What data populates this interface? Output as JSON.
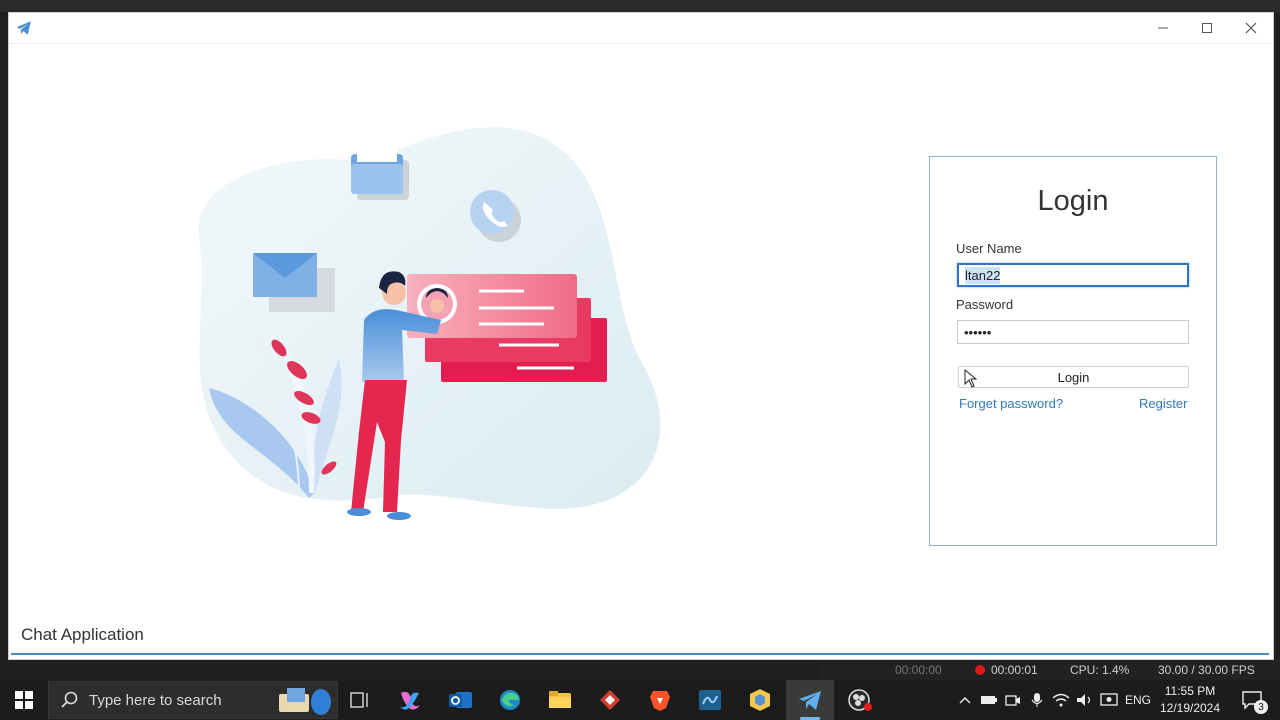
{
  "window": {
    "minimize_symbol": "—",
    "maximize_symbol": "☐",
    "close_symbol": "✕"
  },
  "login": {
    "title": "Login",
    "username_label": "User Name",
    "username_value": "ltan22",
    "password_label": "Password",
    "password_value": "••••••",
    "login_button": "Login",
    "forget_password": "Forget password?",
    "register": "Register"
  },
  "footer": {
    "app_title": "Chat Application"
  },
  "obs": {
    "stream_time": "00:00:00",
    "record_time": "00:00:01",
    "cpu": "CPU: 1.4%",
    "fps": "30.00 / 30.00 FPS"
  },
  "taskbar": {
    "search_placeholder": "Type here to search",
    "language": "ENG",
    "time": "11:55 PM",
    "date": "12/19/2024",
    "notification_count": "3"
  },
  "colors": {
    "accent": "#2a7bbd",
    "panel_border": "#8fb4d4",
    "footer_line": "#4a88c0",
    "taskbar": "#1c1c1c"
  }
}
